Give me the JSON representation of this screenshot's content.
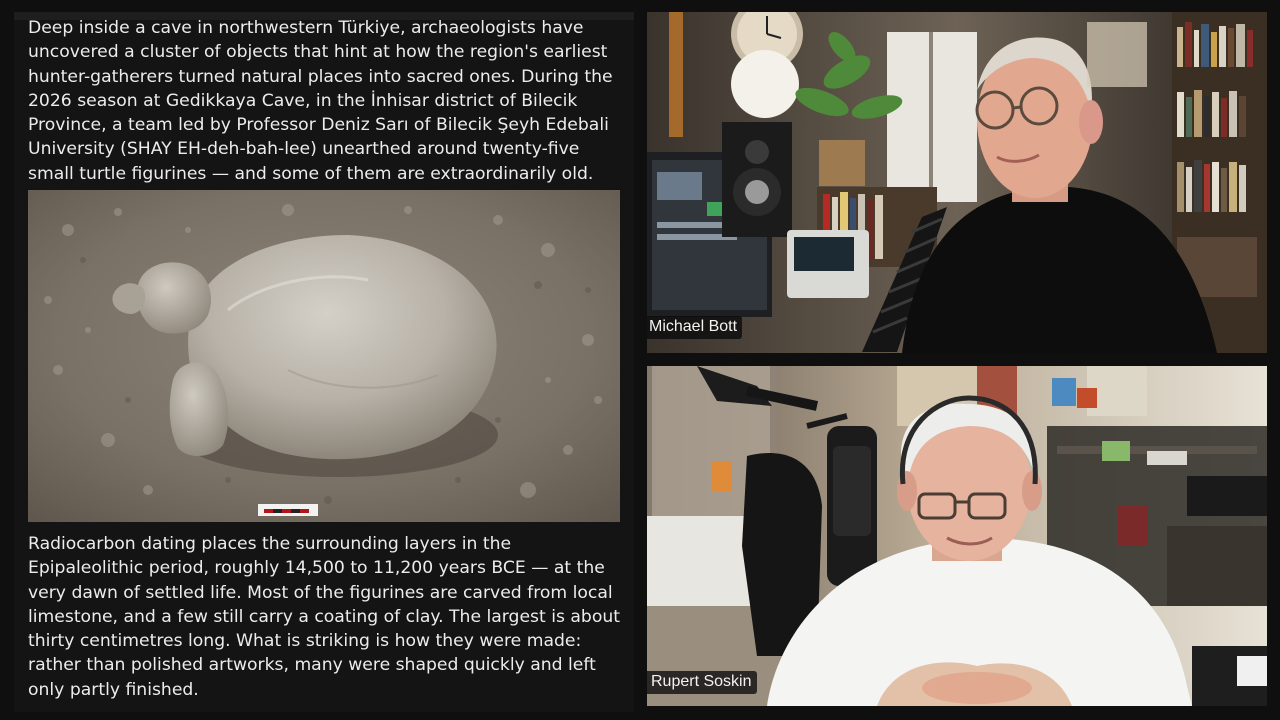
{
  "article": {
    "paragraph_1": "Deep inside a cave in northwestern Türkiye, archaeologists have uncovered a cluster of objects that hint at how the region's earliest hunter-gatherers turned natural places into sacred ones. During the 2026 season at Gedikkaya Cave, in the İnhisar district of Bilecik Province, a team led by Professor Deniz Sarı of Bilecik Şeyh Edebali University (SHAY EH-deh-bah-lee) unearthed around twenty-five small turtle figurines — and some of them are extraordinarily old.",
    "paragraph_2": "Radiocarbon dating places the surrounding layers in the Epipaleolithic period, roughly 14,500 to 11,200 years BCE — at the very dawn of settled life. Most of the figurines are carved from local limestone, and a few still carry a coating of clay. The largest is about thirty centimetres long. What is striking is how they were made: rather than polished artworks, many were shaped quickly and left only partly finished."
  },
  "participants": {
    "top": {
      "name": "Michael Bott"
    },
    "bottom": {
      "name": "Rupert Soskin"
    }
  }
}
